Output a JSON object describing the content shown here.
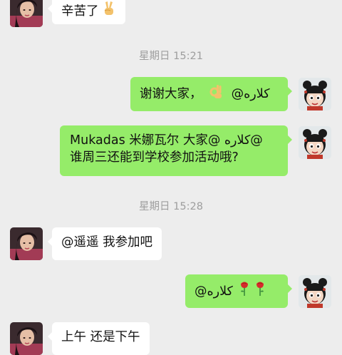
{
  "messages": [
    {
      "type": "in",
      "text": "辛苦了",
      "emoji": "victory-hand-icon"
    },
    {
      "type": "timestamp",
      "text": "星期日 15:21"
    },
    {
      "type": "out",
      "text": "谢谢大家， ",
      "emoji": "ok-hand-icon",
      "mention": "@كلاره"
    },
    {
      "type": "out",
      "line1": "Mukadas 米娜瓦尔  大家@ كلاره@",
      "line2": "谁周三还能到学校参加活动哦?"
    },
    {
      "type": "timestamp",
      "text": "星期日 15:28"
    },
    {
      "type": "in",
      "text": "@遥遥 我参加吧"
    },
    {
      "type": "out",
      "mention": "@كلاره",
      "emoji": "rose-icon"
    },
    {
      "type": "in",
      "text": "上午 还是下午"
    }
  ],
  "colors": {
    "background": "#ededed",
    "outgoing_bubble": "#95ec69",
    "incoming_bubble": "#ffffff",
    "timestamp_text": "#9e9e9e"
  }
}
